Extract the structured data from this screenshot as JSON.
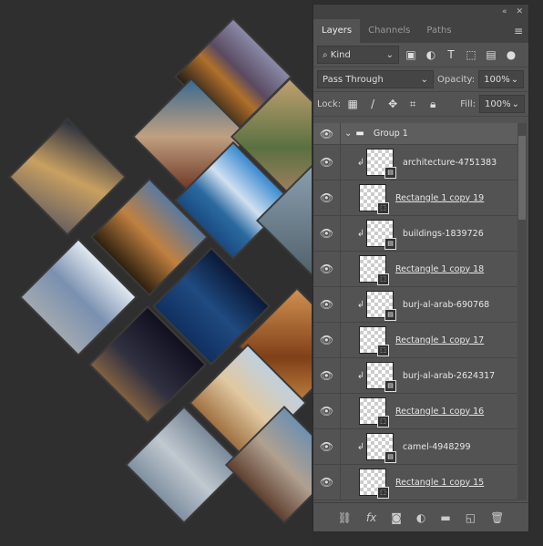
{
  "panel": {
    "tabs": [
      {
        "label": "Layers",
        "active": true
      },
      {
        "label": "Channels"
      },
      {
        "label": "Paths"
      }
    ],
    "collapse_icon": "double-chevron-icon",
    "close_icon": "close-icon",
    "filter": {
      "label": "Kind"
    },
    "blend_mode": "Pass Through",
    "opacity_label": "Opacity:",
    "opacity": "100%",
    "lock_label": "Lock:",
    "fill_label": "Fill:",
    "fill": "100%",
    "group": {
      "name": "Group 1"
    },
    "layers": [
      {
        "name": "architecture-4751383",
        "type": "smart",
        "clipped": true
      },
      {
        "name": "Rectangle 1 copy 19",
        "type": "shape"
      },
      {
        "name": "buildings-1839726",
        "type": "smart",
        "clipped": true
      },
      {
        "name": "Rectangle 1 copy 18",
        "type": "shape"
      },
      {
        "name": "burj-al-arab-690768",
        "type": "smart",
        "clipped": true
      },
      {
        "name": "Rectangle 1 copy 17",
        "type": "shape"
      },
      {
        "name": "burj-al-arab-2624317",
        "type": "smart",
        "clipped": true
      },
      {
        "name": "Rectangle 1 copy 16",
        "type": "shape"
      },
      {
        "name": "camel-4948299",
        "type": "smart",
        "clipped": true
      },
      {
        "name": "Rectangle 1 copy 15",
        "type": "shape"
      }
    ],
    "bottom_icons": [
      "link-icon",
      "fx-icon",
      "mask-icon",
      "adjustment-icon",
      "folder-icon",
      "new-layer-icon",
      "trash-icon"
    ]
  }
}
